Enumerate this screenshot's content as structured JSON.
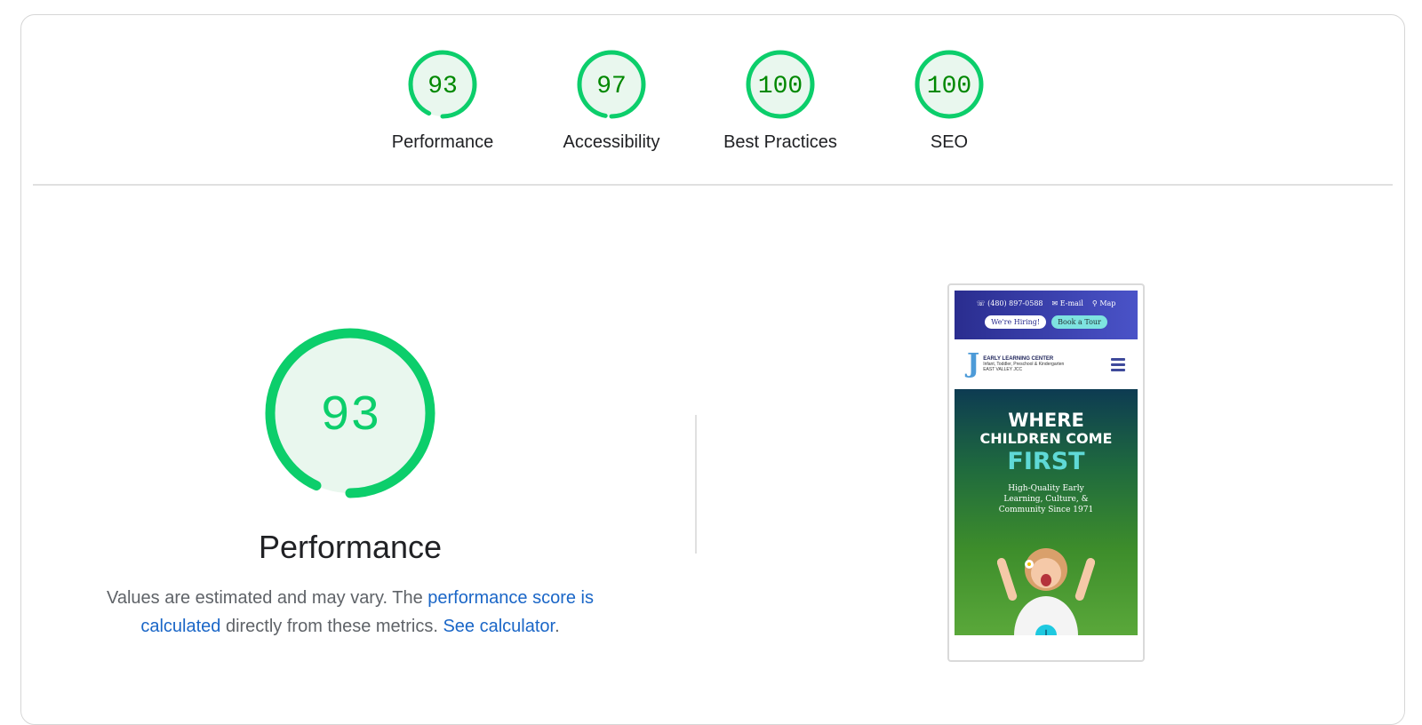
{
  "gauges": [
    {
      "label": "Performance",
      "score": "93"
    },
    {
      "label": "Accessibility",
      "score": "97"
    },
    {
      "label": "Best Practices",
      "score": "100"
    },
    {
      "label": "SEO",
      "score": "100"
    }
  ],
  "colors": {
    "pass": "#0cce6b",
    "pass_fill": "#e9f7ee",
    "score_text": "#008800",
    "link": "#1a66c7"
  },
  "performance": {
    "score": "93",
    "title": "Performance",
    "desc_prefix": "Values are estimated and may vary. The ",
    "desc_link1": "performance score is calculated",
    "desc_middle": " directly from these metrics. ",
    "desc_link2": "See calculator",
    "desc_suffix": "."
  },
  "screenshot": {
    "phone": "(480) 897-0588",
    "email": "E-mail",
    "map": "Map",
    "hiring": "We're Hiring!",
    "tour": "Book a Tour",
    "logo_name": "EARLY LEARNING CENTER",
    "logo_tagline": "Infant, Toddler, Preschool & Kindergarten",
    "logo_place": "EAST VALLEY JCC",
    "hero_line1": "WHERE",
    "hero_line2": "CHILDREN COME",
    "hero_line3": "FIRST",
    "hero_sub": "High-Quality Early Learning, Culture, & Community Since 1971"
  }
}
